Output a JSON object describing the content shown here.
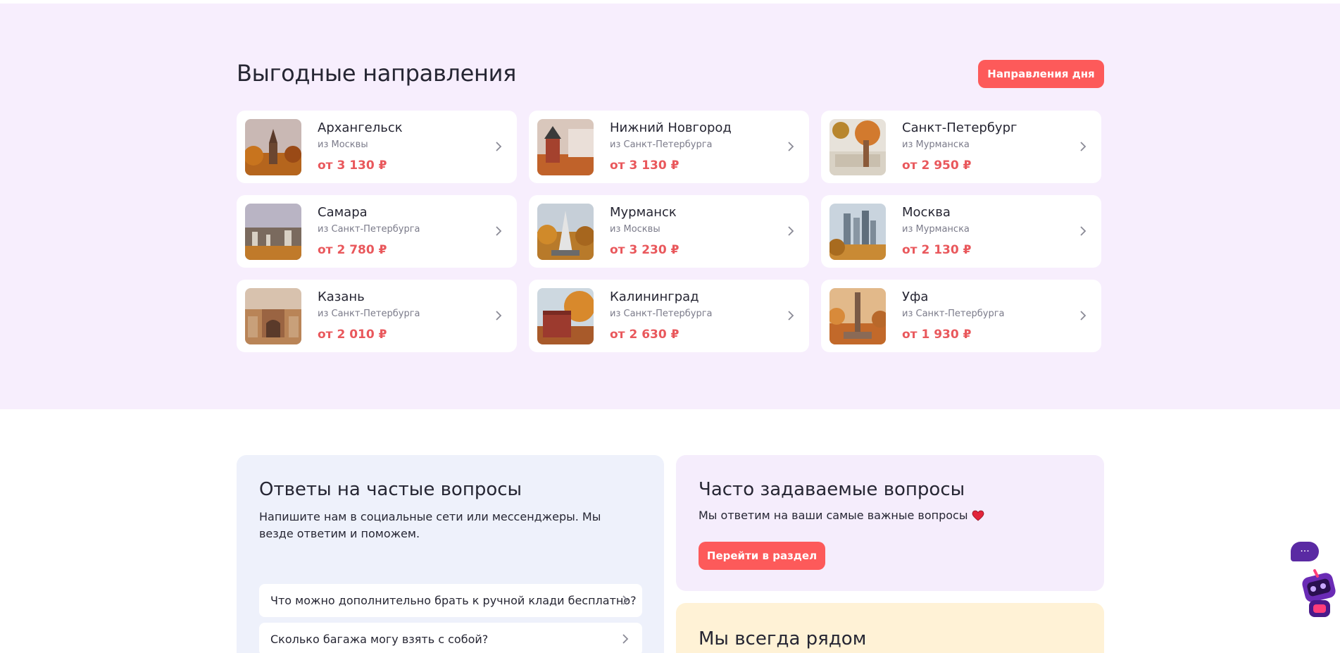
{
  "section": {
    "title": "Выгодные направления",
    "day_button": "Направления дня"
  },
  "destinations": [
    {
      "city": "Архангельск",
      "from": "из Москвы",
      "price": "от 3 130 ₽"
    },
    {
      "city": "Нижний Новгород",
      "from": "из Санкт-Петербурга",
      "price": "от 3 130 ₽"
    },
    {
      "city": "Санкт-Петербург",
      "from": "из Мурманска",
      "price": "от 2 950 ₽"
    },
    {
      "city": "Самара",
      "from": "из Санкт-Петербурга",
      "price": "от 2 780 ₽"
    },
    {
      "city": "Мурманск",
      "from": "из Москвы",
      "price": "от 3 230 ₽"
    },
    {
      "city": "Москва",
      "from": "из Мурманска",
      "price": "от 2 130 ₽"
    },
    {
      "city": "Казань",
      "from": "из Санкт-Петербурга",
      "price": "от 2 010 ₽"
    },
    {
      "city": "Калининград",
      "from": "из Санкт-Петербурга",
      "price": "от 2 630 ₽"
    },
    {
      "city": "Уфа",
      "from": "из Санкт-Петербурга",
      "price": "от 1 930 ₽"
    }
  ],
  "faq": {
    "title": "Ответы на частые вопросы",
    "description": "Напишите нам в социальные сети или мессенджеры. Мы везде ответим и поможем.",
    "questions": [
      "Что можно дополнительно брать к ручной клади бесплатно?",
      "Сколько багажа могу взять с собой?"
    ]
  },
  "often": {
    "title": "Часто задаваемые вопросы",
    "description": "Мы ответим на ваши самые важные вопросы",
    "button": "Перейти в раздел"
  },
  "near": {
    "title": "Мы всегда рядом"
  },
  "chat": {
    "bubble": "···"
  },
  "colors": {
    "accent": "#fd5a5a",
    "price": "#e9585c",
    "section_bg": "#f7eefd",
    "faq_bg": "#eef1fb",
    "often_bg": "#f5edfc",
    "near_bg": "#fff2d6"
  },
  "icons": {
    "card_arrow": "chevron-right-icon",
    "heart": "heart-icon",
    "assistant": "robot-icon"
  }
}
